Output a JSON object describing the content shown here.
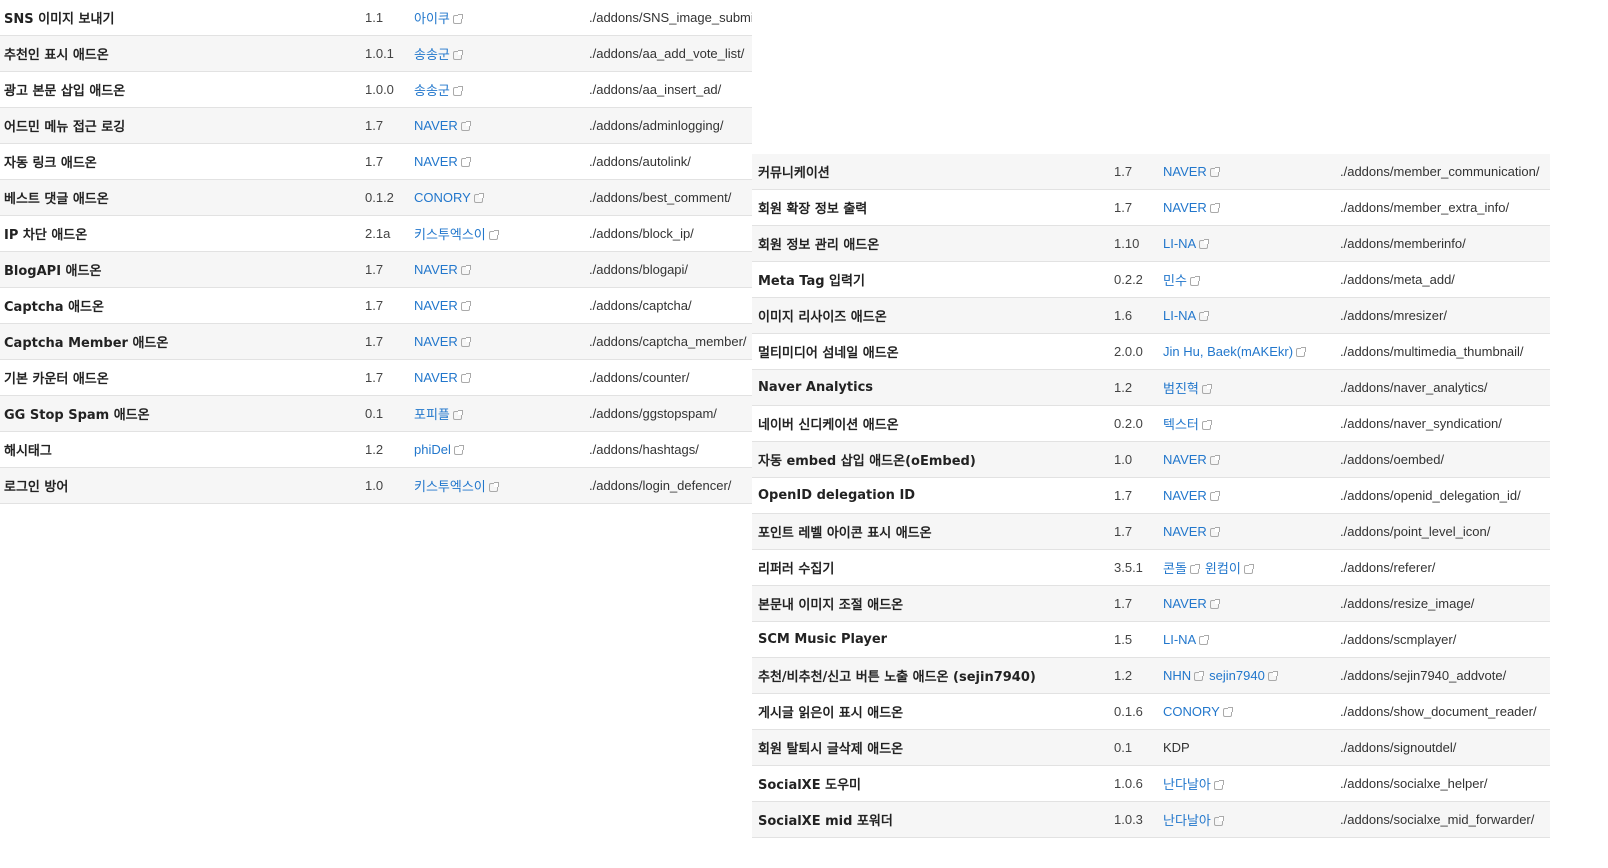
{
  "left_rows": [
    {
      "name": "SNS 이미지 보내기",
      "version": "1.1",
      "authors": [
        {
          "name": "아이쿠",
          "link": true
        }
      ],
      "path": "./addons/SNS_image_submi"
    },
    {
      "name": "추천인 표시 애드온",
      "version": "1.0.1",
      "authors": [
        {
          "name": "송송군",
          "link": true
        }
      ],
      "path": "./addons/aa_add_vote_list/"
    },
    {
      "name": "광고 본문 삽입 애드온",
      "version": "1.0.0",
      "authors": [
        {
          "name": "송송군",
          "link": true
        }
      ],
      "path": "./addons/aa_insert_ad/"
    },
    {
      "name": "어드민 메뉴 접근 로깅",
      "version": "1.7",
      "authors": [
        {
          "name": "NAVER",
          "link": true
        }
      ],
      "path": "./addons/adminlogging/"
    },
    {
      "name": "자동 링크 애드온",
      "version": "1.7",
      "authors": [
        {
          "name": "NAVER",
          "link": true
        }
      ],
      "path": "./addons/autolink/"
    },
    {
      "name": "베스트 댓글 애드온",
      "version": "0.1.2",
      "authors": [
        {
          "name": "CONORY",
          "link": true
        }
      ],
      "path": "./addons/best_comment/"
    },
    {
      "name": "IP 차단 애드온",
      "version": "2.1a",
      "authors": [
        {
          "name": "키스투엑스이",
          "link": true
        }
      ],
      "path": "./addons/block_ip/"
    },
    {
      "name": "BlogAPI 애드온",
      "version": "1.7",
      "authors": [
        {
          "name": "NAVER",
          "link": true
        }
      ],
      "path": "./addons/blogapi/"
    },
    {
      "name": "Captcha 애드온",
      "version": "1.7",
      "authors": [
        {
          "name": "NAVER",
          "link": true
        }
      ],
      "path": "./addons/captcha/"
    },
    {
      "name": "Captcha Member 애드온",
      "version": "1.7",
      "authors": [
        {
          "name": "NAVER",
          "link": true
        }
      ],
      "path": "./addons/captcha_member/"
    },
    {
      "name": "기본 카운터 애드온",
      "version": "1.7",
      "authors": [
        {
          "name": "NAVER",
          "link": true
        }
      ],
      "path": "./addons/counter/"
    },
    {
      "name": "GG Stop Spam 애드온",
      "version": "0.1",
      "authors": [
        {
          "name": "포피플",
          "link": true
        }
      ],
      "path": "./addons/ggstopspam/"
    },
    {
      "name": "해시태그",
      "version": "1.2",
      "authors": [
        {
          "name": "phiDel",
          "link": true
        }
      ],
      "path": "./addons/hashtags/"
    },
    {
      "name": "로그인 방어",
      "version": "1.0",
      "authors": [
        {
          "name": "키스투엑스이",
          "link": true
        }
      ],
      "path": "./addons/login_defencer/"
    }
  ],
  "right_rows": [
    {
      "name": "커뮤니케이션",
      "version": "1.7",
      "authors": [
        {
          "name": "NAVER",
          "link": true
        }
      ],
      "path": "./addons/member_communication/"
    },
    {
      "name": "회원 확장 정보 출력",
      "version": "1.7",
      "authors": [
        {
          "name": "NAVER",
          "link": true
        }
      ],
      "path": "./addons/member_extra_info/"
    },
    {
      "name": "회원 정보 관리 애드온",
      "version": "1.10",
      "authors": [
        {
          "name": "LI-NA",
          "link": true
        }
      ],
      "path": "./addons/memberinfo/"
    },
    {
      "name": "Meta Tag 입력기",
      "version": "0.2.2",
      "authors": [
        {
          "name": "민수",
          "link": true
        }
      ],
      "path": "./addons/meta_add/"
    },
    {
      "name": "이미지 리사이즈 애드온",
      "version": "1.6",
      "authors": [
        {
          "name": "LI-NA",
          "link": true
        }
      ],
      "path": "./addons/mresizer/"
    },
    {
      "name": "멀티미디어 섬네일 애드온",
      "version": "2.0.0",
      "authors": [
        {
          "name": "Jin Hu, Baek(mAKEkr)",
          "link": true
        }
      ],
      "path": "./addons/multimedia_thumbnail/"
    },
    {
      "name": "Naver Analytics",
      "version": "1.2",
      "authors": [
        {
          "name": "범진혁",
          "link": true
        }
      ],
      "path": "./addons/naver_analytics/"
    },
    {
      "name": "네이버 신디케이션 애드온",
      "version": "0.2.0",
      "authors": [
        {
          "name": "텍스터",
          "link": true
        }
      ],
      "path": "./addons/naver_syndication/"
    },
    {
      "name": "자동 embed 삽입 애드온(oEmbed)",
      "version": "1.0",
      "authors": [
        {
          "name": "NAVER",
          "link": true
        }
      ],
      "path": "./addons/oembed/"
    },
    {
      "name": "OpenID delegation ID",
      "version": "1.7",
      "authors": [
        {
          "name": "NAVER",
          "link": true
        }
      ],
      "path": "./addons/openid_delegation_id/"
    },
    {
      "name": "포인트 레벨 아이콘 표시 애드온",
      "version": "1.7",
      "authors": [
        {
          "name": "NAVER",
          "link": true
        }
      ],
      "path": "./addons/point_level_icon/"
    },
    {
      "name": "리퍼러 수집기",
      "version": "3.5.1",
      "authors": [
        {
          "name": "콘돌",
          "link": true
        },
        {
          "name": "윈컴이",
          "link": true
        }
      ],
      "path": "./addons/referer/"
    },
    {
      "name": "본문내 이미지 조절 애드온",
      "version": "1.7",
      "authors": [
        {
          "name": "NAVER",
          "link": true
        }
      ],
      "path": "./addons/resize_image/"
    },
    {
      "name": "SCM Music Player",
      "version": "1.5",
      "authors": [
        {
          "name": "LI-NA",
          "link": true
        }
      ],
      "path": "./addons/scmplayer/"
    },
    {
      "name": "추천/비추천/신고 버튼 노출 애드온 (sejin7940)",
      "version": "1.2",
      "authors": [
        {
          "name": "NHN",
          "link": true
        },
        {
          "name": "sejin7940",
          "link": true
        }
      ],
      "path": "./addons/sejin7940_addvote/"
    },
    {
      "name": "게시글 읽은이 표시 애드온",
      "version": "0.1.6",
      "authors": [
        {
          "name": "CONORY",
          "link": true
        }
      ],
      "path": "./addons/show_document_reader/"
    },
    {
      "name": "회원 탈퇴시 글삭제 애드온",
      "version": "0.1",
      "authors": [
        {
          "name": "KDP",
          "link": false
        }
      ],
      "path": "./addons/signoutdel/"
    },
    {
      "name": "SocialXE 도우미",
      "version": "1.0.6",
      "authors": [
        {
          "name": "난다날아",
          "link": true
        }
      ],
      "path": "./addons/socialxe_helper/"
    },
    {
      "name": "SocialXE mid 포워더",
      "version": "1.0.3",
      "authors": [
        {
          "name": "난다날아",
          "link": true
        }
      ],
      "path": "./addons/socialxe_mid_forwarder/"
    }
  ]
}
